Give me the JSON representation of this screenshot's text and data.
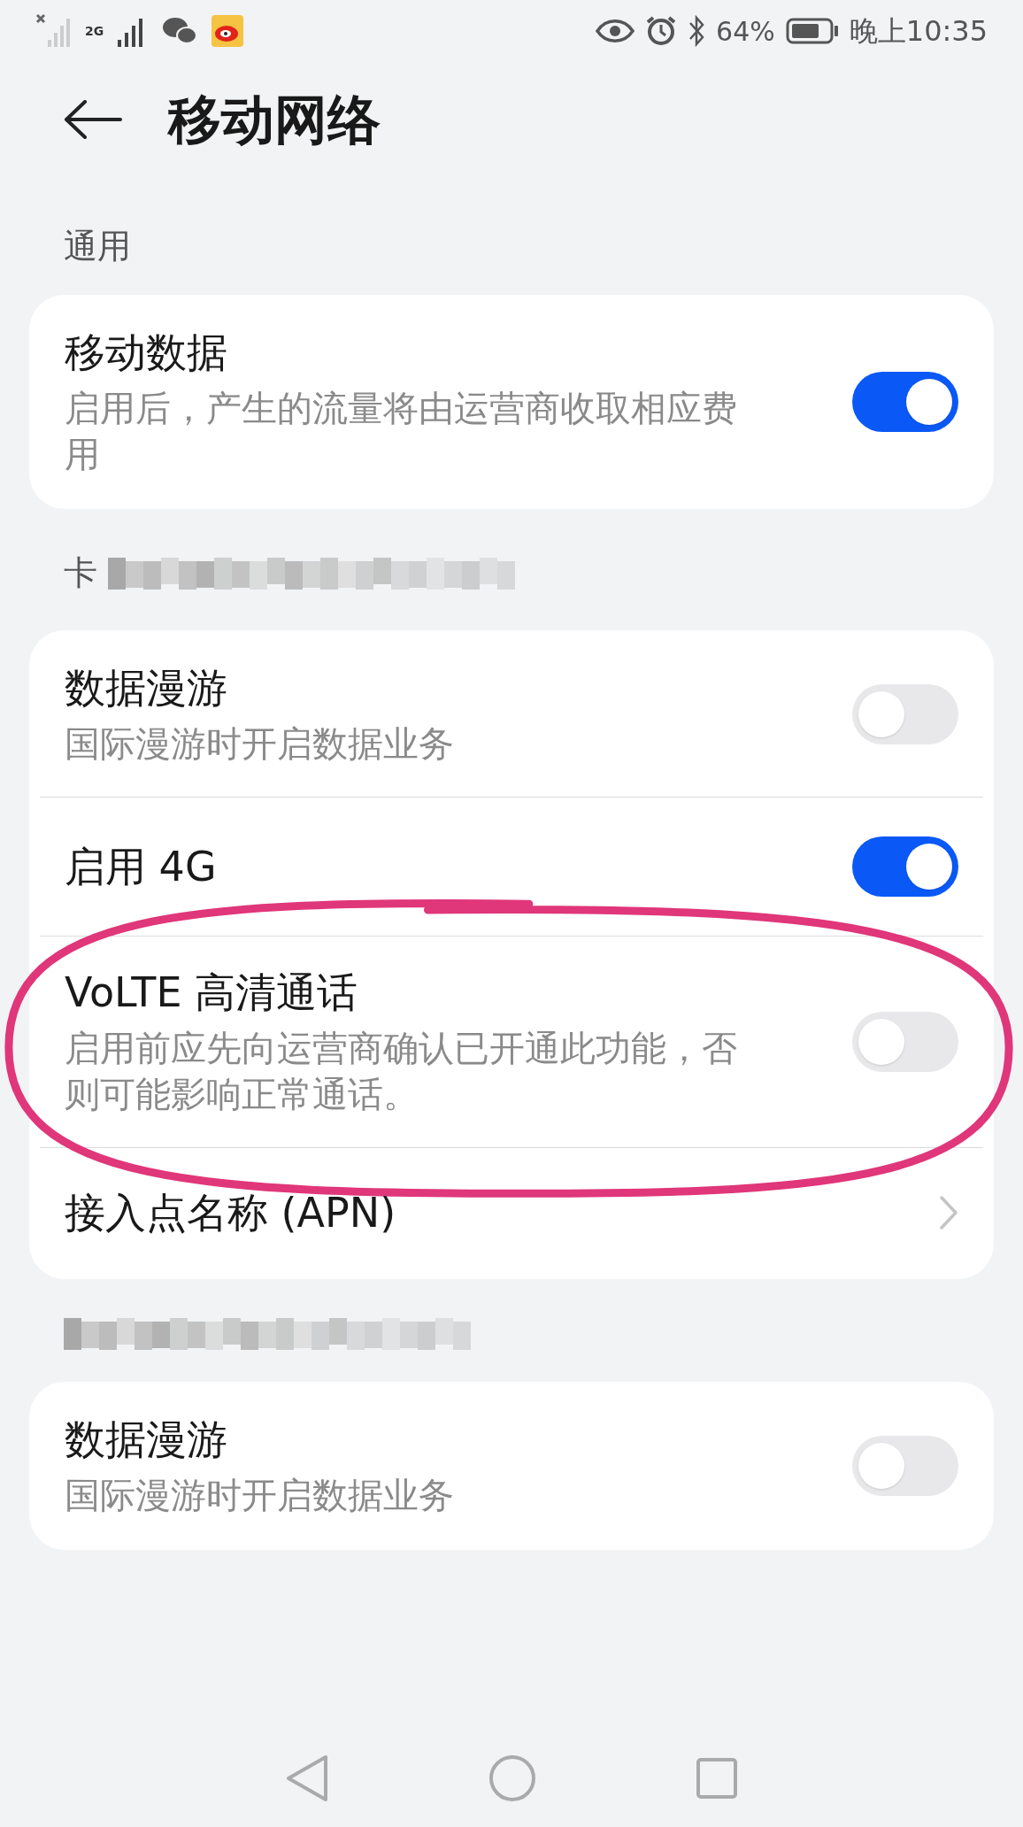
{
  "status_bar": {
    "signal_label": "2G",
    "battery": "64%",
    "time": "晚上10:35"
  },
  "header": {
    "title": "移动网络"
  },
  "sections": [
    {
      "heading": "通用",
      "redacted": false,
      "rows": [
        {
          "kind": "toggle",
          "title": "移动数据",
          "subtitle": "启用后，产生的流量将由运营商收取相应费用",
          "on": true,
          "circled": false
        }
      ]
    },
    {
      "heading": "卡",
      "redacted": true,
      "rows": [
        {
          "kind": "toggle",
          "title": "数据漫游",
          "subtitle": "国际漫游时开启数据业务",
          "on": false,
          "circled": false
        },
        {
          "kind": "toggle",
          "title": "启用 4G",
          "on": true,
          "circled": false
        },
        {
          "kind": "toggle",
          "title": "VoLTE 高清通话",
          "subtitle": "启用前应先向运营商确认已开通此功能，否则可能影响正常通话。",
          "on": false,
          "circled": true
        },
        {
          "kind": "link",
          "title": "接入点名称 (APN)",
          "circled": false
        }
      ]
    },
    {
      "redacted": true,
      "rows": [
        {
          "kind": "toggle",
          "title": "数据漫游",
          "subtitle": "国际漫游时开启数据业务",
          "on": false,
          "circled": false
        }
      ]
    }
  ]
}
